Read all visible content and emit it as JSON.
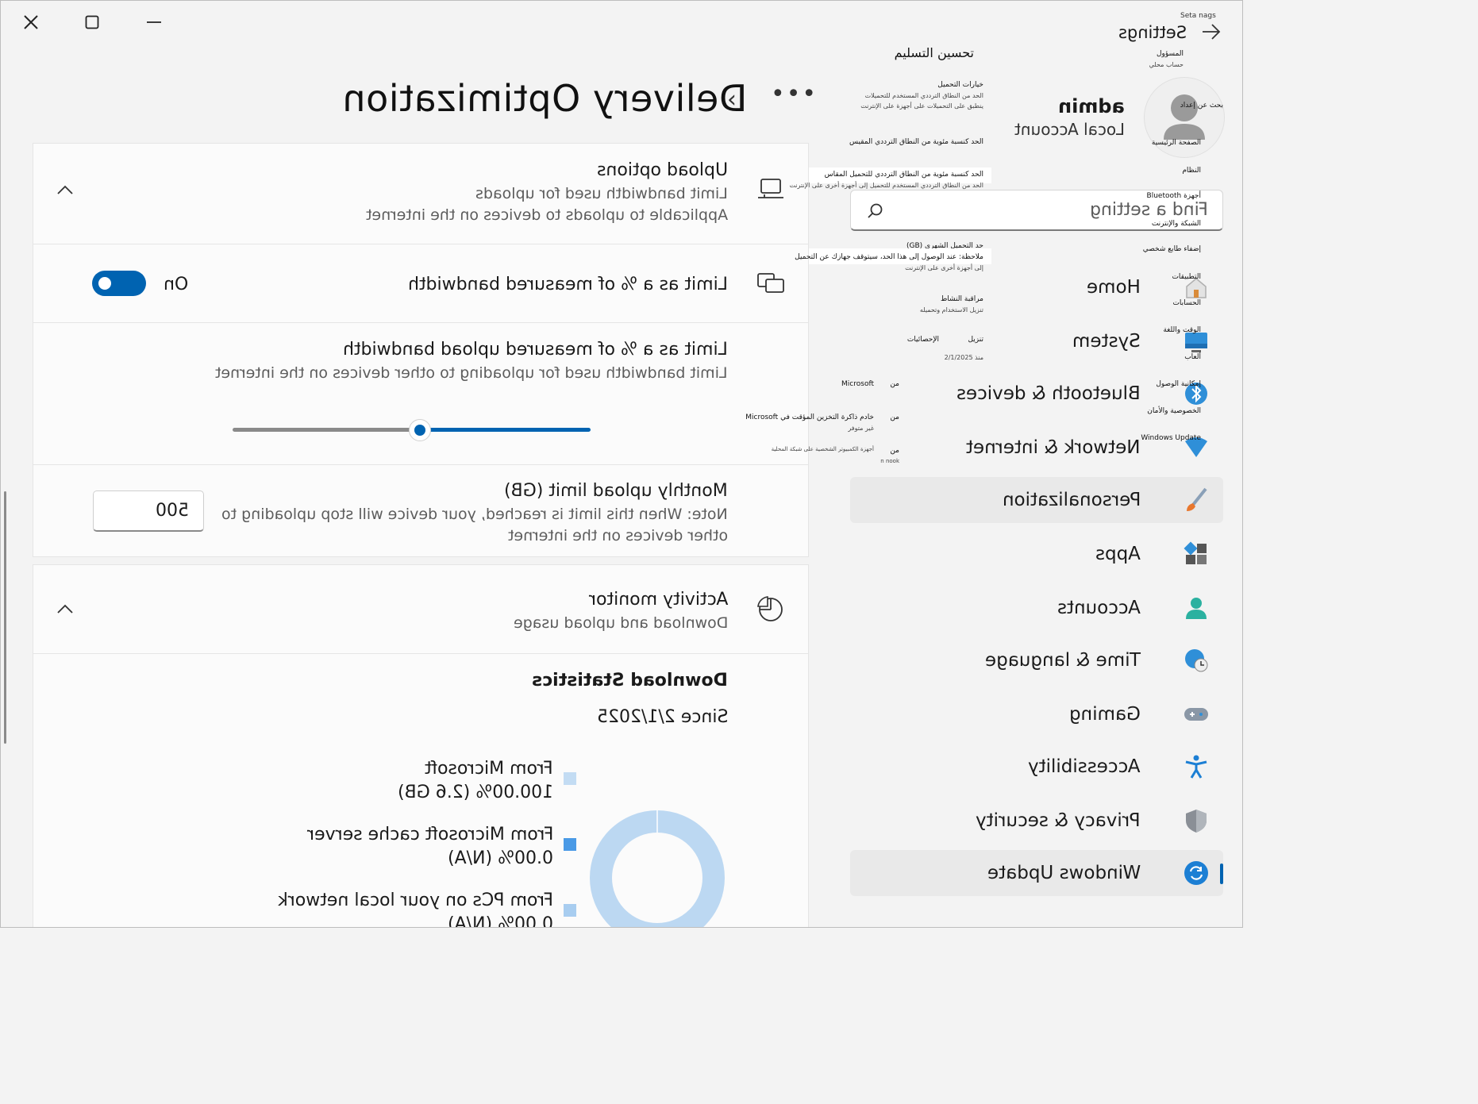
{
  "window": {
    "caption_buttons": {
      "close": "close-icon",
      "maximize": "maximize-icon",
      "minimize": "minimize-icon"
    }
  },
  "header": {
    "page_title": "Delivery Optimization",
    "more_label": "•••"
  },
  "upload_options": {
    "title": "Upload options",
    "subtitle_1": "Limit bandwidth used for uploads",
    "subtitle_2": "Applicable to uploads to devices on the internet"
  },
  "limit_measured": {
    "title": "Limit as a % of measured bandwidth",
    "toggle_state": "On",
    "toggle_on": true
  },
  "limit_upload": {
    "title": "Limit as a % of measured upload bandwidth",
    "subtitle": "Limit bandwidth used for uploading to other devices on the internet",
    "slider_value_fraction": 0.52
  },
  "monthly_limit": {
    "title": "Monthly upload limit (GB)",
    "note_1": "Note: When this limit is reached, your device will stop uploading to",
    "note_2": "other devices on the internet",
    "value": "500"
  },
  "activity_monitor": {
    "title": "Activity monitor",
    "subtitle": "Download and upload usage"
  },
  "download_stats": {
    "heading": "Download Statistics",
    "since": "Since 2/1/2025",
    "items": [
      {
        "label": "From Microsoft",
        "value": "100.00%  (2.6 GB)",
        "color": "#c3dcf3"
      },
      {
        "label": "From Microsoft cache server",
        "value": "0.00%  (N/A)",
        "color": "#4a9ae6"
      },
      {
        "label": "From PCs on your local network",
        "value": "0.00%  (N/A)",
        "color": "#a8cdf0"
      }
    ],
    "donut_color": "#bcd8f2"
  },
  "sidebar": {
    "settings_label": "Settings",
    "settings_small": "Seta nags",
    "user_name": "admin",
    "user_sub": "Local Account",
    "search_placeholder": "Find a setting",
    "items": [
      {
        "label": "Home",
        "icon": "home-icon"
      },
      {
        "label": "System",
        "icon": "system-icon"
      },
      {
        "label": "Bluetooth & devices",
        "icon": "bluetooth-icon"
      },
      {
        "label": "Network & internet",
        "icon": "network-icon"
      },
      {
        "label": "Personalization",
        "icon": "brush-icon"
      },
      {
        "label": "Apps",
        "icon": "apps-icon"
      },
      {
        "label": "Accounts",
        "icon": "accounts-icon"
      },
      {
        "label": "Time & language",
        "icon": "globe-clock-icon"
      },
      {
        "label": "Gaming",
        "icon": "gamepad-icon"
      },
      {
        "label": "Accessibility",
        "icon": "accessibility-icon"
      },
      {
        "label": "Privacy & security",
        "icon": "shield-icon"
      },
      {
        "label": "Windows Update",
        "icon": "update-icon"
      }
    ],
    "selected_item": "Windows Update"
  },
  "arabic_overlay": {
    "heading": "تحسين التسليم",
    "responsible": "المسؤول",
    "local_account": "حساب محلي",
    "search_settings": "بحث عن إعداد",
    "home": "الصفحة الرئيسية",
    "system": "النظام",
    "bluetooth": "أجهزة Bluetooth",
    "network": "الشبكة والإنترنت",
    "personalize": "إضفاء طابع شخصي",
    "apps": "التطبيقات",
    "accounts": "الحسابات",
    "time": "الوقت واللغة",
    "games": "ألعاب",
    "accessibility": "إمكانية الوصول",
    "privacy": "الخصوصية والأمان",
    "windows_update": "Windows Update",
    "upload_options": "خيارات التحميل",
    "upload_desc_1": "الحد من النطاق الترددي المستخدم للتحميلات",
    "upload_desc_2": "ينطبق على التحميلات على أجهزة على الإنترنت",
    "limit_pct": "الحد كنسبة مئوية من النطاق الترددي المقيس",
    "limit_upload_pct": "الحد كنسبة مئوية من النطاق الترددي للتحميل المقاس",
    "limit_upload_desc": "الحد من النطاق الترددي المستخدم للتحميل إلى أجهزة أخرى على الإنترنت",
    "monthly": "حد التحميل الشهري (GB)",
    "note_1": "ملاحظة: عند الوصول إلى هذا الحد، سيتوقف جهازك عن التحميل",
    "note_2": "إلى أجهزة أخرى على الإنترنت",
    "activity": "مراقبة النشاط",
    "activity_desc": "تنزيل الاستخدام وتحميله",
    "download": "تنزيل",
    "stats": "الإحصائيات",
    "since": "منذ 2/1/2025",
    "from": "من",
    "from_ms": "Microsoft",
    "cache": "خادم ذاكرة التخزين المؤقت في Microsoft",
    "unavailable": "غير متوفر",
    "local_pcs": "أجهزة الكمبيوتر الشخصية على شبكة المحلية",
    "n_nook": "n nook"
  }
}
